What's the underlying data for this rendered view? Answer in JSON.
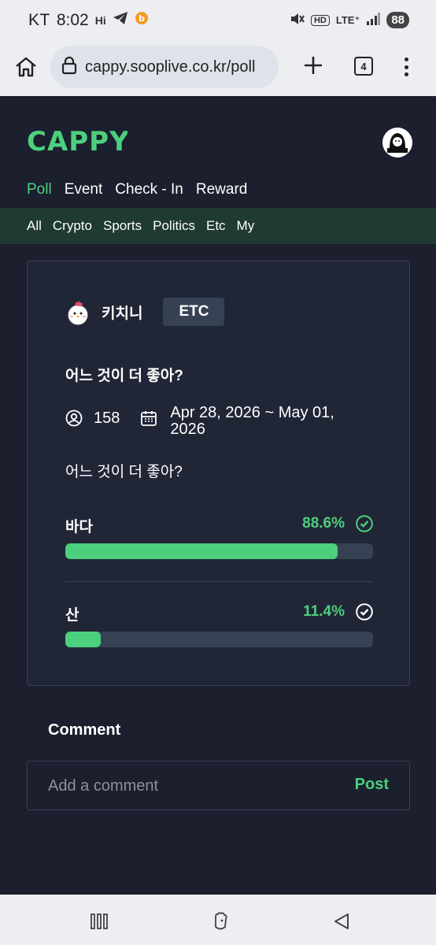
{
  "status_bar": {
    "carrier": "KT",
    "time": "8:02",
    "left_icons": [
      "hi-icon",
      "telegram-icon",
      "app-icon"
    ],
    "hi_text": "Hi",
    "hd_text": "HD",
    "lte_text": "LTE⁺",
    "battery": "88"
  },
  "browser": {
    "url": "cappy.sooplive.co.kr/poll",
    "tab_count": "4"
  },
  "app": {
    "logo": "CAPPY",
    "brand_color": "#4cd07d",
    "main_nav": [
      {
        "label": "Poll",
        "active": true
      },
      {
        "label": "Event",
        "active": false
      },
      {
        "label": "Check - In",
        "active": false
      },
      {
        "label": "Reward",
        "active": false
      }
    ],
    "sub_nav": [
      "All",
      "Crypto",
      "Sports",
      "Politics",
      "Etc",
      "My"
    ]
  },
  "poll": {
    "author": "키치니",
    "category": "ETC",
    "title": "어느 것이 더 좋아?",
    "participants": "158",
    "date_range": "Apr 28, 2026 ~ May 01, 2026",
    "description": "어느 것이 더 좋아?",
    "options": [
      {
        "label": "바다",
        "percent": "88.6%",
        "fill_percent": 88.6
      },
      {
        "label": "산",
        "percent": "11.4%",
        "fill_percent": 11.4
      }
    ]
  },
  "comments": {
    "heading": "Comment",
    "placeholder": "Add a comment",
    "post_label": "Post"
  }
}
